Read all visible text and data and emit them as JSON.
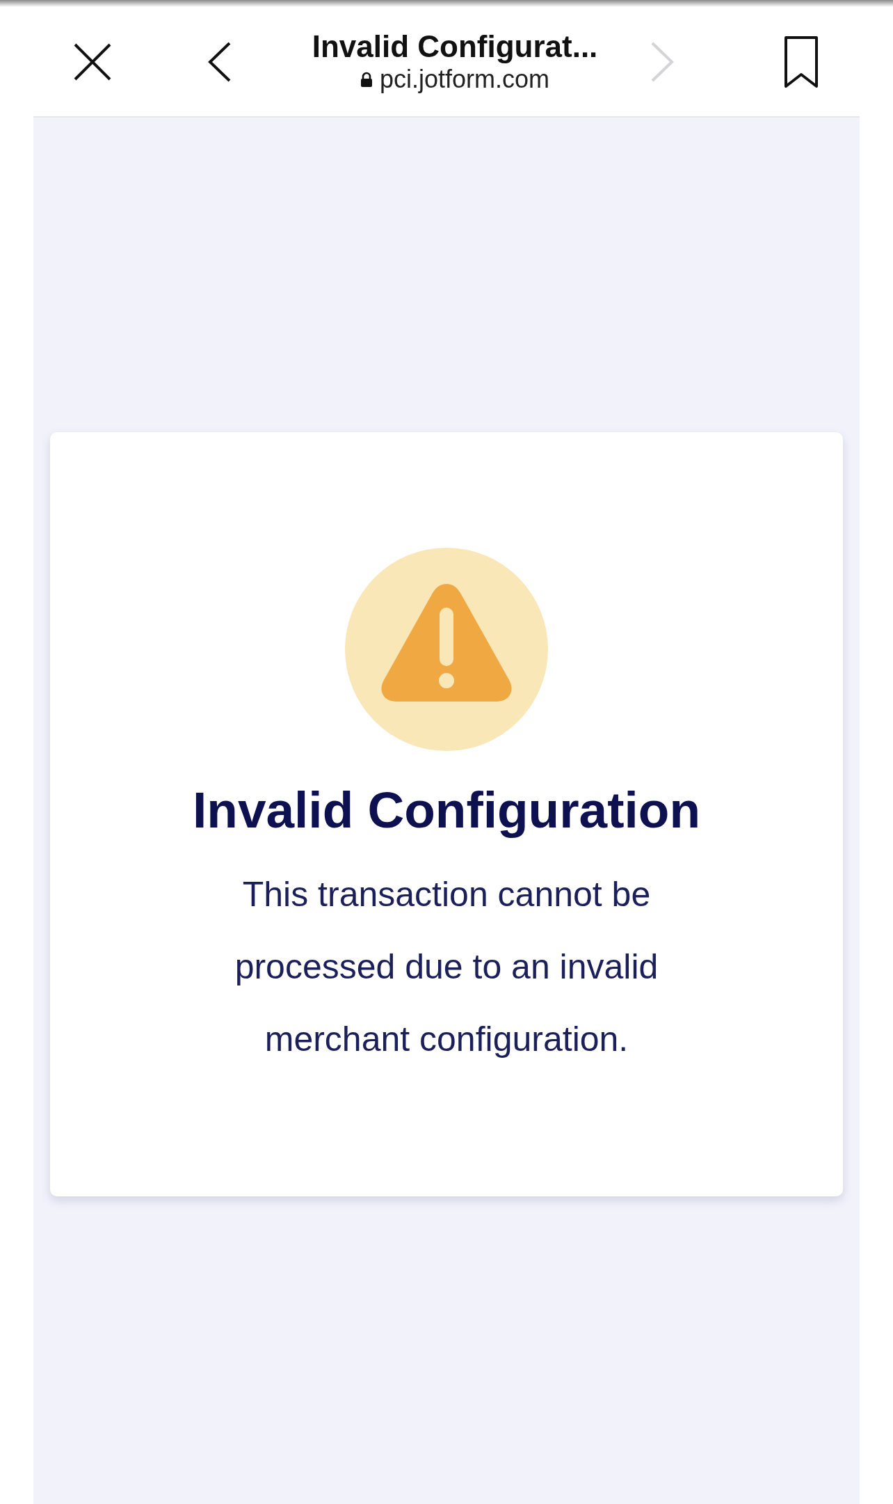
{
  "browser_bar": {
    "page_title": "Invalid Configurat...",
    "secure": true,
    "url": "pci.jotform.com",
    "back": {
      "disabled": false
    },
    "forward": {
      "disabled": true
    }
  },
  "error_card": {
    "kind": "warning",
    "title": "Invalid Configuration",
    "message": "This transaction cannot be processed due to an invalid merchant configuration."
  }
}
